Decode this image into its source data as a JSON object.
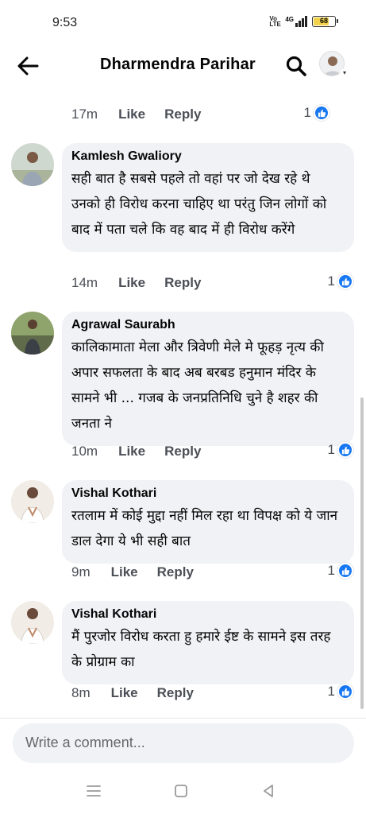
{
  "status_bar": {
    "time": "9:53",
    "volte_label": "Vo LTE",
    "network_label": "4G",
    "battery_level": "68"
  },
  "header": {
    "title": "Dharmendra Parihar",
    "icons": [
      "back-arrow-icon",
      "search-icon",
      "profile-avatar"
    ]
  },
  "previous_comment_meta": {
    "time": "17m",
    "like_label": "Like",
    "reply_label": "Reply",
    "reaction_count": "1"
  },
  "comments": [
    {
      "author": "Kamlesh Gwaliory",
      "text": "सही बात है सबसे पहले तो वहां पर जो देख रहे थे उनको ही विरोध करना चाहिए था परंतु जिन लोगों को बाद में पता चले कि वह बाद में ही विरोध करेंगे",
      "time": "14m",
      "like_label": "Like",
      "reply_label": "Reply",
      "reaction_count": "1"
    },
    {
      "author": "Agrawal Saurabh",
      "text": "कालिकामाता मेला और  त्रिवेणी मेले मे फूहड़ नृत्य की अपार सफलता के बाद अब बरबड हनुमान मंदिर के सामने भी ... गजब के जनप्रतिनिधि चुने है शहर की जनता ने",
      "time": "10m",
      "like_label": "Like",
      "reply_label": "Reply",
      "reaction_count": "1"
    },
    {
      "author": "Vishal Kothari",
      "text": "रतलाम में कोई मुद्दा नहीं मिल रहा था विपक्ष को ये जान डाल देगा ये भी सही बात",
      "time": "9m",
      "like_label": "Like",
      "reply_label": "Reply",
      "reaction_count": "1"
    },
    {
      "author": "Vishal Kothari",
      "text": "मैं पुरजोर विरोध करता हु हमारे ईष्ट के सामने इस तरह के प्रोग्राम का",
      "time": "8m",
      "like_label": "Like",
      "reply_label": "Reply",
      "reaction_count": "1"
    }
  ],
  "composer": {
    "placeholder": "Write a comment..."
  },
  "system_nav": {
    "icons": [
      "menu-icon",
      "home-icon",
      "back-icon"
    ]
  },
  "colors": {
    "bubble": "#f0f2f5",
    "like_blue": "#1877f2",
    "meta_text": "#4b4f56"
  }
}
